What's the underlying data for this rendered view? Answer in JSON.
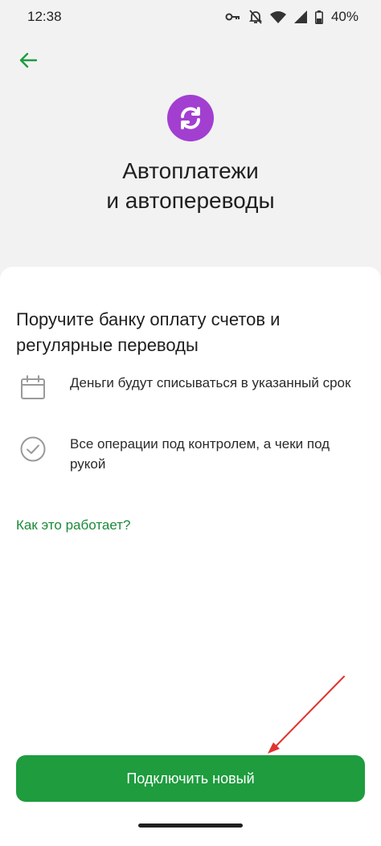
{
  "status_bar": {
    "time": "12:38",
    "battery": "40%",
    "icons": [
      "key-icon",
      "bell-off-icon",
      "wifi-icon",
      "signal-icon",
      "battery-icon"
    ]
  },
  "header": {
    "back_icon": "arrow-left-icon",
    "hero_icon": "sync-icon",
    "title": "Автоплатежи\nи автопереводы"
  },
  "sheet": {
    "heading": "Поручите банку оплату счетов и регулярные переводы",
    "features": [
      {
        "icon": "calendar-icon",
        "text": "Деньги будут списываться в указанный срок"
      },
      {
        "icon": "check-circle-icon",
        "text": "Все операции под контролем, а чеки под рукой"
      }
    ],
    "link": "Как это работает?",
    "button": "Подключить новый"
  },
  "colors": {
    "accent_green": "#1e9c3e",
    "link_green": "#1a8a3a",
    "hero_purple": "#a23fd1",
    "annotation_red": "#e0332f"
  }
}
